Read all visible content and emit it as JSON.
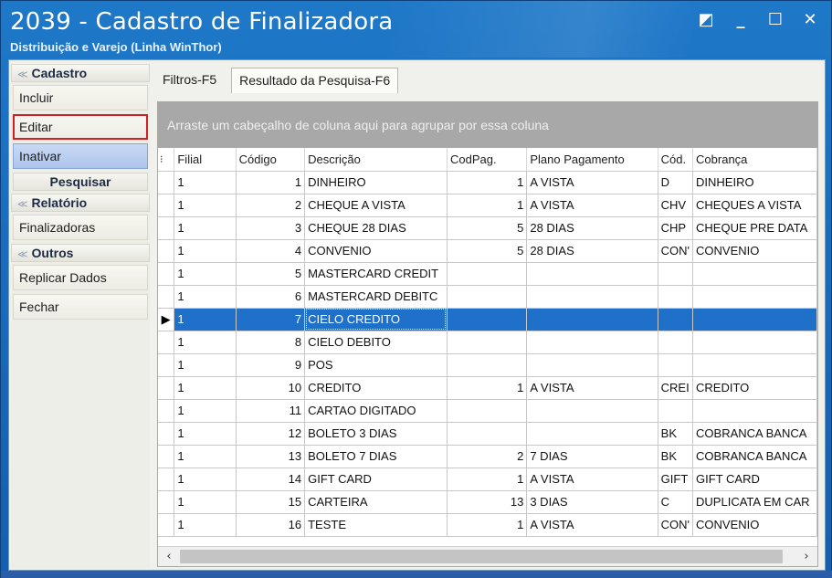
{
  "window": {
    "title": "2039 - Cadastro de Finalizadora",
    "subtitle": "Distribuição e Varejo (Linha WinThor)",
    "controls": [
      "restore-icon",
      "minimize-icon",
      "maximize-icon",
      "close-icon"
    ]
  },
  "sidebar": {
    "cadastro": {
      "label": "Cadastro",
      "items": [
        "Incluir",
        "Editar",
        "Inativar"
      ]
    },
    "pesquisar": "Pesquisar",
    "relatorio": {
      "label": "Relatório",
      "items": [
        "Finalizadoras"
      ]
    },
    "outros": {
      "label": "Outros",
      "items": [
        "Replicar Dados",
        "Fechar"
      ]
    }
  },
  "tabs": [
    "Filtros-F5",
    "Resultado da Pesquisa-F6"
  ],
  "grid": {
    "group_hint": "Arraste um cabeçalho de coluna aqui para agrupar por essa coluna",
    "columns": [
      "Filial",
      "Código",
      "Descrição",
      "CodPag.",
      "Plano Pagamento",
      "Cód.",
      "Cobrança"
    ],
    "rows": [
      [
        "1",
        "1",
        "DINHEIRO",
        "1",
        "A VISTA",
        "D",
        "DINHEIRO"
      ],
      [
        "1",
        "2",
        "CHEQUE A VISTA",
        "1",
        "A VISTA",
        "CHV",
        "CHEQUES A VISTA"
      ],
      [
        "1",
        "3",
        "CHEQUE 28 DIAS",
        "5",
        "28 DIAS",
        "CHP",
        "CHEQUE PRE DATA"
      ],
      [
        "1",
        "4",
        "CONVENIO",
        "5",
        "28 DIAS",
        "CON'",
        "CONVENIO"
      ],
      [
        "1",
        "5",
        "MASTERCARD CREDIT",
        "",
        "",
        "",
        ""
      ],
      [
        "1",
        "6",
        "MASTERCARD DEBITC",
        "",
        "",
        "",
        ""
      ],
      [
        "1",
        "7",
        "CIELO CREDITO",
        "",
        "",
        "",
        ""
      ],
      [
        "1",
        "8",
        "CIELO DEBITO",
        "",
        "",
        "",
        ""
      ],
      [
        "1",
        "9",
        "POS",
        "",
        "",
        "",
        ""
      ],
      [
        "1",
        "10",
        "CREDITO",
        "1",
        "A VISTA",
        "CREI",
        "CREDITO"
      ],
      [
        "1",
        "11",
        "CARTAO DIGITADO",
        "",
        "",
        "",
        ""
      ],
      [
        "1",
        "12",
        "BOLETO 3 DIAS",
        "",
        "",
        "BK",
        "COBRANCA BANCA"
      ],
      [
        "1",
        "13",
        "BOLETO 7 DIAS",
        "2",
        "7 DIAS",
        "BK",
        "COBRANCA BANCA"
      ],
      [
        "1",
        "14",
        "GIFT CARD",
        "1",
        "A VISTA",
        "GIFT",
        "GIFT CARD"
      ],
      [
        "1",
        "15",
        "CARTEIRA",
        "13",
        "3 DIAS",
        "C",
        "DUPLICATA EM CAR"
      ],
      [
        "1",
        "16",
        "TESTE",
        "1",
        "A VISTA",
        "CON'",
        "CONVENIO"
      ]
    ],
    "selected_row": 6,
    "scroll_left_icon": "‹",
    "scroll_right_icon": "›"
  },
  "colors": {
    "titlebar": "#1a6dbd",
    "selection": "#1f70c8",
    "highlight_border": "#d42020"
  }
}
